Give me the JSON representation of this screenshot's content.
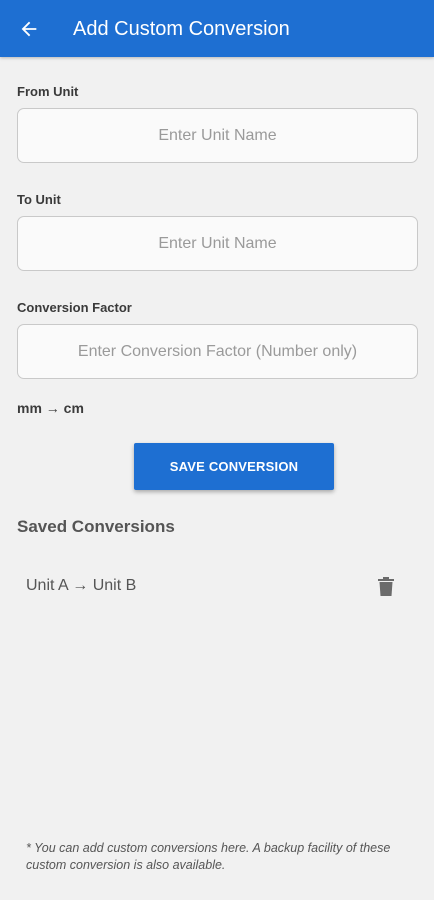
{
  "header": {
    "title": "Add Custom Conversion",
    "back_icon": "arrow-left-icon",
    "background": "#1e6fd2"
  },
  "form": {
    "from_unit": {
      "label": "From Unit",
      "placeholder": "Enter Unit Name",
      "value": ""
    },
    "to_unit": {
      "label": "To Unit",
      "placeholder": "Enter Unit Name",
      "value": ""
    },
    "conversion_factor": {
      "label": "Conversion Factor",
      "placeholder": "Enter Conversion Factor (Number only)",
      "value": ""
    },
    "preview": "mm → cm",
    "save_label": "SAVE CONVERSION"
  },
  "saved": {
    "title": "Saved Conversions",
    "items": [
      {
        "label": "Unit A → Unit B",
        "delete_icon": "trash-icon"
      }
    ]
  },
  "footnote": "* You can add custom conversions here. A backup facility of these custom conversion is also available."
}
